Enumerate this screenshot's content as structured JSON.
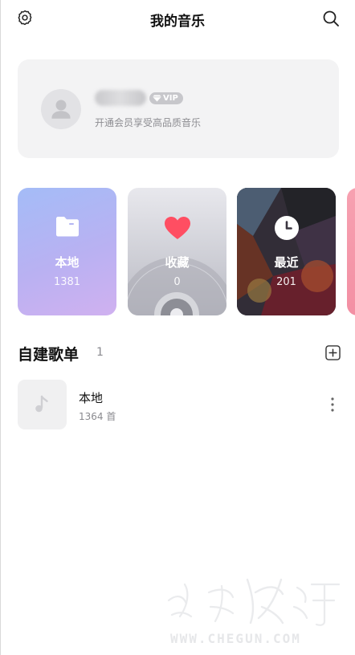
{
  "header": {
    "title": "我的音乐",
    "settings_icon": "gear-icon",
    "search_icon": "search-icon"
  },
  "profile": {
    "avatar_icon": "user-avatar-icon",
    "vip_badge": "VIP",
    "subtitle": "开通会员享受高品质音乐"
  },
  "cards": [
    {
      "label": "本地",
      "count": "1381",
      "icon": "folder-icon"
    },
    {
      "label": "收藏",
      "count": "0",
      "icon": "heart-icon"
    },
    {
      "label": "最近",
      "count": "201",
      "icon": "clock-icon"
    }
  ],
  "playlists_section": {
    "title": "自建歌单",
    "count": "1",
    "add_icon": "add-square-icon"
  },
  "playlists": [
    {
      "name": "本地",
      "subtitle": "1364 首",
      "cover_icon": "music-note-icon"
    }
  ],
  "watermark": {
    "url": "WWW.CHEGUN.COM"
  },
  "colors": {
    "card_local_start": "#a4bcf7",
    "card_local_end": "#d0b1f0",
    "heart": "#ff4e62",
    "card_peek": "#f38fa3"
  }
}
